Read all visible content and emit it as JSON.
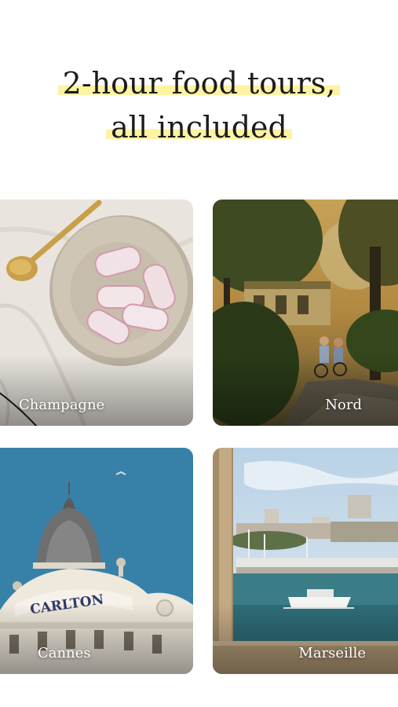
{
  "headline": {
    "line1": "2-hour food tours,",
    "line2": "all included"
  },
  "tours": [
    {
      "name": "Champagne"
    },
    {
      "name": "Nord"
    },
    {
      "name": "Cannes"
    },
    {
      "name": "Marseille"
    }
  ],
  "cannes_sign": "CARLTON",
  "colors": {
    "highlight": "#fdf3a1",
    "text": "#1c1c1c"
  }
}
